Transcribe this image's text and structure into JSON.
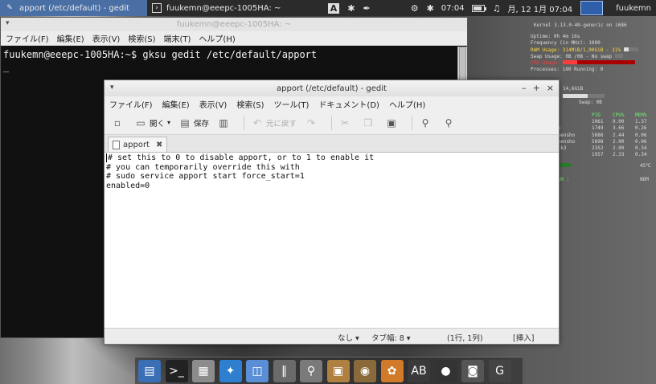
{
  "top_panel": {
    "tasks": [
      {
        "label": "apport (/etc/default) - gedit",
        "icon": "text-editor-icon",
        "active": true
      },
      {
        "label": "fuukemn@eeepc-1005HA: ~",
        "icon": "terminal-icon",
        "active": false
      }
    ],
    "tray": {
      "input_method_label": "A",
      "time": "07:04",
      "date": "月, 12 1月 07:04",
      "battery_level": 0.85,
      "user": "fuukemn"
    }
  },
  "terminal": {
    "title": "fuukemn@eeepc-1005HA: ~",
    "menu": [
      "ファイル(F)",
      "編集(E)",
      "表示(V)",
      "検索(S)",
      "端末(T)",
      "ヘルプ(H)"
    ],
    "lines": [
      "fuukemn@eeepc-1005HA:~$ gksu gedit /etc/default/apport",
      "_"
    ]
  },
  "gedit": {
    "title": "apport (/etc/default) - gedit",
    "menu": [
      "ファイル(F)",
      "編集(E)",
      "表示(V)",
      "検索(S)",
      "ツール(T)",
      "ドキュメント(D)",
      "ヘルプ(H)"
    ],
    "toolbar": {
      "open_label": "開く",
      "save_label": "保存",
      "undo_label": "元に戻す"
    },
    "tab_label": "apport",
    "content_lines": [
      "# set this to 0 to disable apport, or to 1 to enable it",
      "# you can temporarily override this with",
      "# sudo service apport start force_start=1",
      "enabled=0"
    ],
    "status": {
      "syntax": "なし",
      "tab_width": "タブ幅: 8",
      "position": "(1行, 1列)",
      "insert_mode": "[挿入]"
    }
  },
  "conky": {
    "kernel": "Kernel 3.13.0-40-generic on i686",
    "uptime": "Uptime: 0h 4m 16s",
    "frequency": "Frequency (in MHz): 1000",
    "ram_usage": "RAM Usage: 314MiB/1,00GiB - 31%",
    "swap_usage": "Swap Usage: 0B  /0B  - No swap",
    "cpu_usage": "CPU Usage:",
    "processes": "Processes: 180  Running: 0",
    "disk_size": "14,6GiB",
    "swap_free": "Swap: 0B",
    "cols": [
      "PID",
      "CPU%",
      "MEM%"
    ],
    "procs": [
      [
        "",
        "1061",
        "0.00",
        "1.37"
      ],
      [
        "on",
        "1749",
        "3.66",
        "0.26"
      ],
      [
        "reensho",
        "5886",
        "2.44",
        "0.06"
      ],
      [
        "reensho",
        "5898",
        "2.00",
        "0.06"
      ],
      [
        "gtk3",
        "2352",
        "2.00",
        "0.34"
      ],
      [
        "",
        "1957",
        "2.33",
        "0.34"
      ]
    ],
    "temp": "45℃",
    "fan_label": "FAN :",
    "fan_value": "NOM"
  },
  "dock": {
    "items": [
      {
        "name": "dock-show-desktop",
        "icon": "show-desktop-icon",
        "glyph": "▤",
        "color": "#3a6fb5"
      },
      {
        "name": "dock-terminal",
        "icon": "terminal-icon",
        "glyph": ">_",
        "color": "#222222"
      },
      {
        "name": "dock-file-manager",
        "icon": "file-manager-icon",
        "glyph": "▦",
        "color": "#8c8c8c"
      },
      {
        "name": "dock-browser",
        "icon": "browser-icon",
        "glyph": "✦",
        "color": "#2e7fd0"
      },
      {
        "name": "dock-image-viewer",
        "icon": "image-viewer-icon",
        "glyph": "◫",
        "color": "#5a8fd8"
      },
      {
        "name": "dock-mixer",
        "icon": "mixer-icon",
        "glyph": "‖",
        "color": "#6a6a6a"
      },
      {
        "name": "dock-search",
        "icon": "search-icon",
        "glyph": "⚲",
        "color": "#7a7a7a"
      },
      {
        "name": "dock-archive",
        "icon": "archive-icon",
        "glyph": "▣",
        "color": "#b08040"
      },
      {
        "name": "dock-media-player",
        "icon": "media-player-icon",
        "glyph": "◉",
        "color": "#8a6a3a"
      },
      {
        "name": "dock-graphics",
        "icon": "graphics-icon",
        "glyph": "✿",
        "color": "#d07a2a"
      },
      {
        "name": "dock-font-viewer",
        "icon": "font-viewer-icon",
        "glyph": "AB",
        "color": "#3a3a3a"
      },
      {
        "name": "dock-camera",
        "icon": "camera-icon",
        "glyph": "●",
        "color": "#333333"
      },
      {
        "name": "dock-screenshot",
        "icon": "screenshot-icon",
        "glyph": "◙",
        "color": "#555555"
      },
      {
        "name": "dock-settings",
        "icon": "settings-icon",
        "glyph": "G",
        "color": "#444444"
      }
    ]
  }
}
